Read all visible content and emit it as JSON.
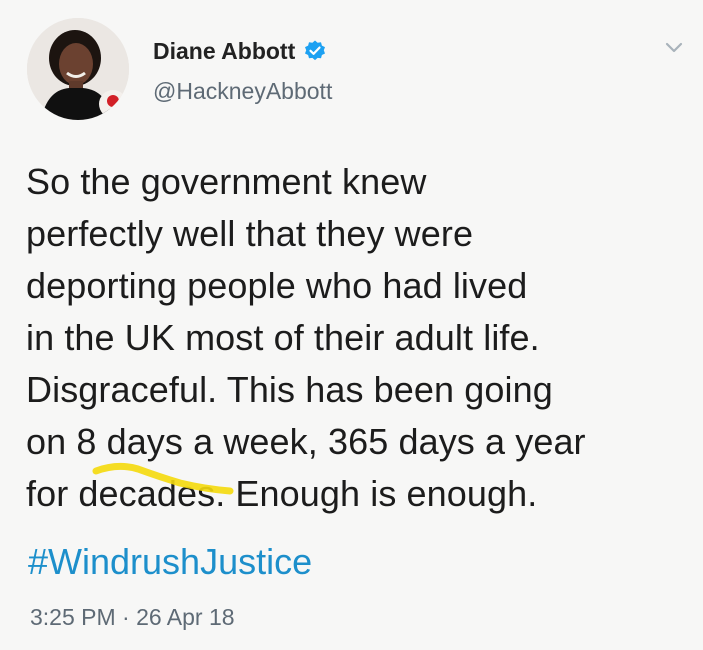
{
  "author": {
    "display_name": "Diane Abbott",
    "handle": "@HackneyAbbott",
    "verified": true,
    "avatar_icon": "profile-photo"
  },
  "tweet": {
    "lines": [
      "So the government knew",
      "perfectly well that they were",
      "deporting people who had lived",
      "in the UK most of their adult life.",
      "Disgraceful. This has been going",
      "on 8 days a week, 365 days a year",
      "for decades. Enough is enough."
    ],
    "hashtag": "#WindrushJustice",
    "timestamp": "3:25 PM · 26 Apr 18"
  },
  "icons": {
    "verified": "verified-badge-icon",
    "menu": "chevron-down-icon"
  },
  "colors": {
    "link": "#1d8fcb",
    "verified": "#1da1f2",
    "secondary_text": "#5e6a75",
    "highlight_mark": "#f4d90c"
  }
}
